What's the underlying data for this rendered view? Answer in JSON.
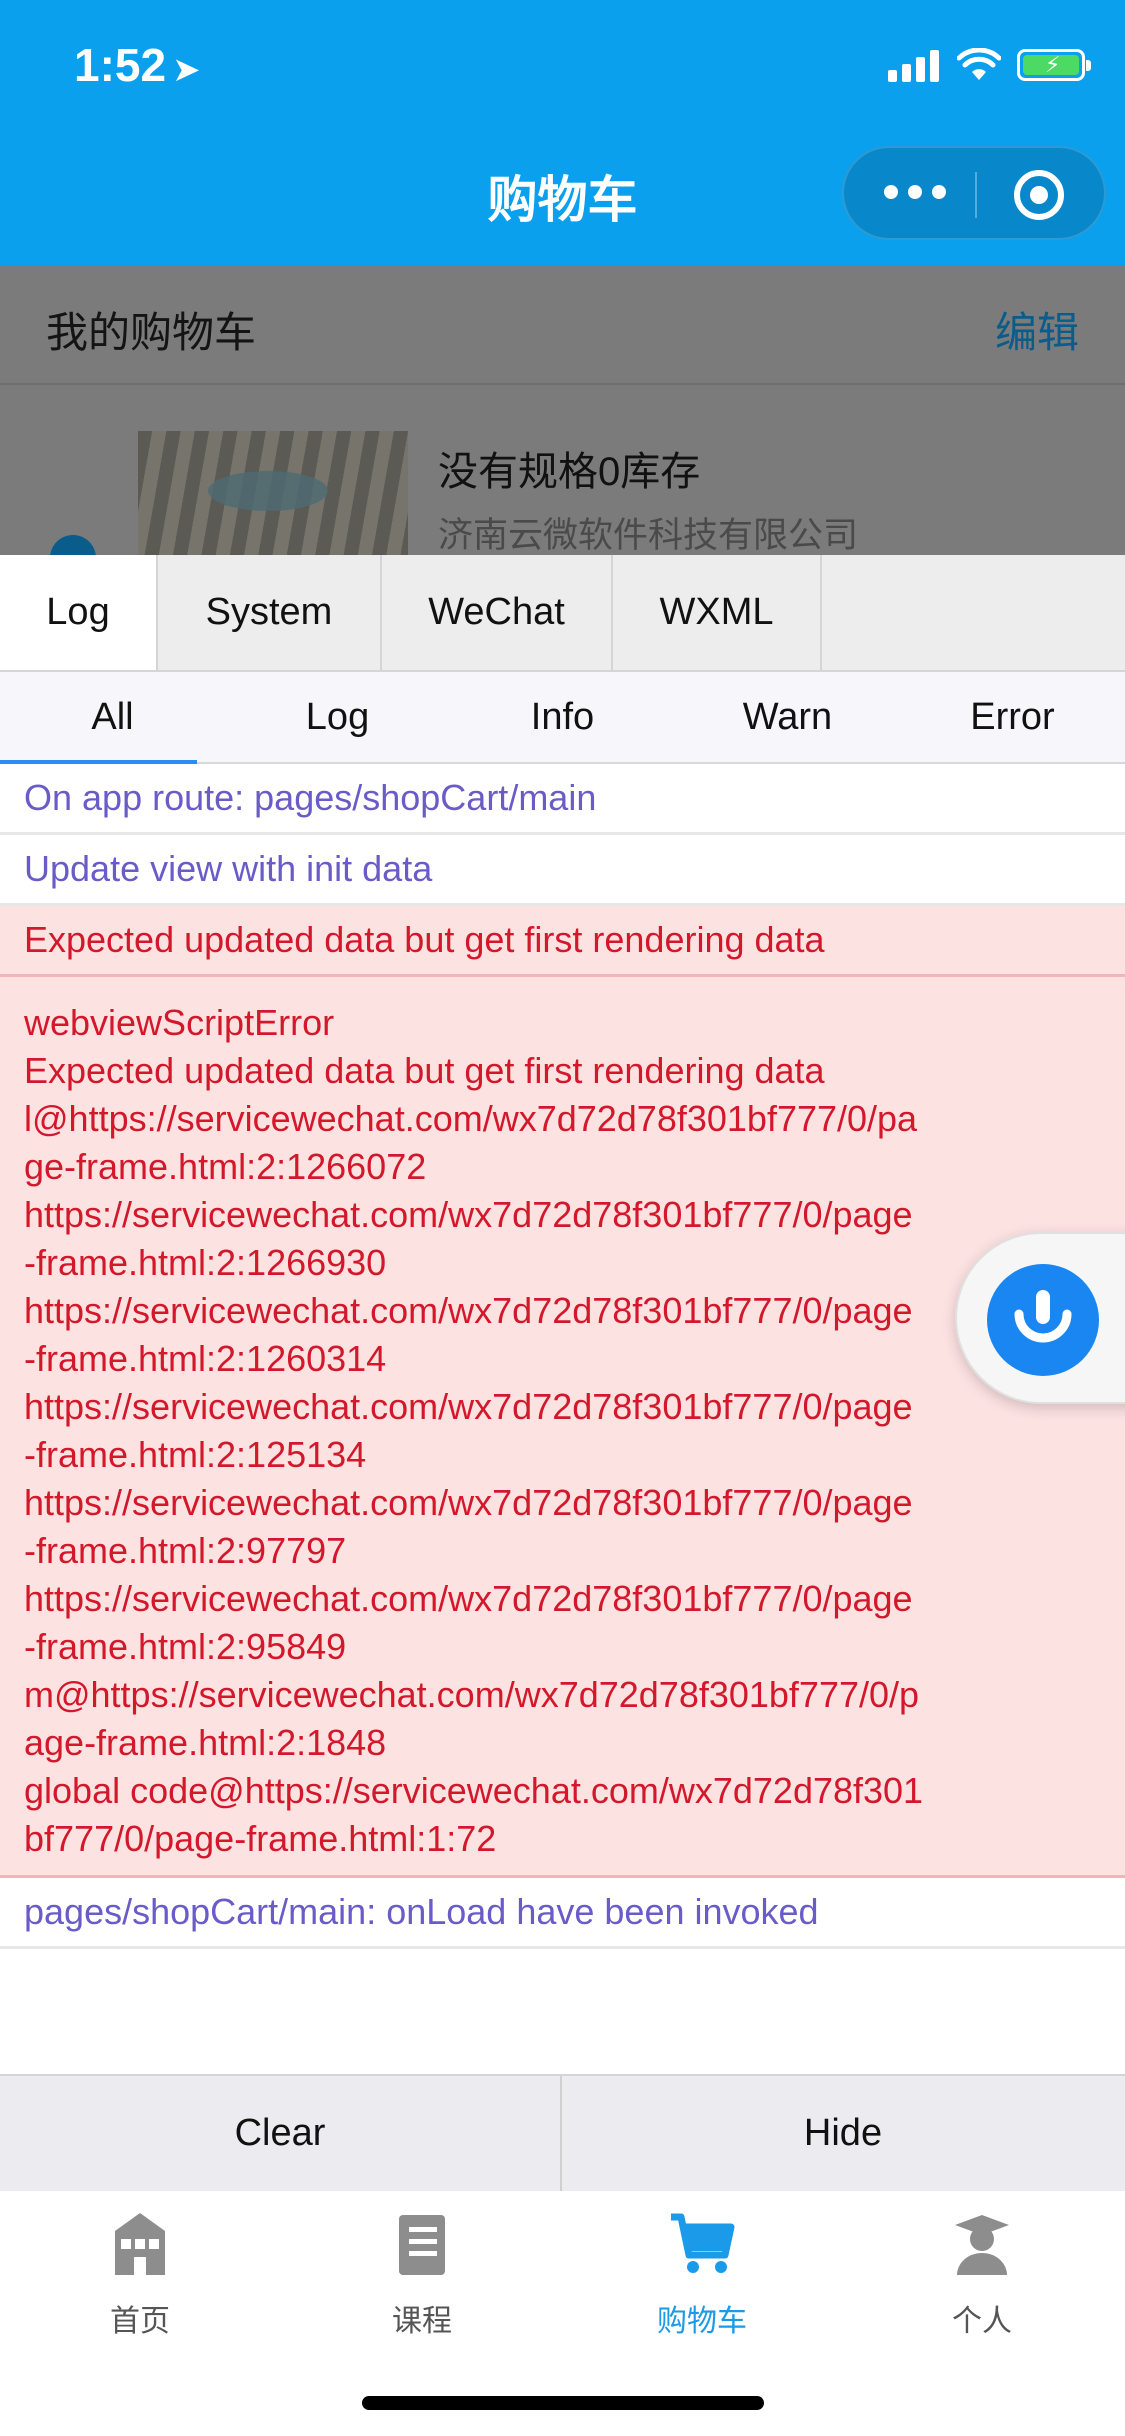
{
  "status_bar": {
    "time": "1:52"
  },
  "nav": {
    "title": "购物车"
  },
  "cart": {
    "header_title": "我的购物车",
    "edit_label": "编辑",
    "item": {
      "name": "没有规格0库存",
      "shop": "济南云微软件科技有限公司"
    }
  },
  "console": {
    "tabs": [
      "Log",
      "System",
      "WeChat",
      "WXML"
    ],
    "subtabs": [
      "All",
      "Log",
      "Info",
      "Warn",
      "Error"
    ],
    "logs": [
      {
        "type": "log",
        "lines": [
          "On app route: pages/shopCart/main"
        ]
      },
      {
        "type": "log",
        "lines": [
          "Update view with init data"
        ]
      },
      {
        "type": "error",
        "lines": [
          "Expected updated data but get first rendering data"
        ]
      },
      {
        "type": "error",
        "lines": [
          "webviewScriptError",
          "Expected updated data but get first rendering data",
          "l@https://servicewechat.com/wx7d72d78f301bf777/0/page-frame.html:2:1266072",
          "https://servicewechat.com/wx7d72d78f301bf777/0/page-frame.html:2:1266930",
          "https://servicewechat.com/wx7d72d78f301bf777/0/page-frame.html:2:1260314",
          "https://servicewechat.com/wx7d72d78f301bf777/0/page-frame.html:2:125134",
          "https://servicewechat.com/wx7d72d78f301bf777/0/page-frame.html:2:97797",
          "https://servicewechat.com/wx7d72d78f301bf777/0/page-frame.html:2:95849",
          "m@https://servicewechat.com/wx7d72d78f301bf777/0/page-frame.html:2:1848",
          "global code@https://servicewechat.com/wx7d72d78f301bf777/0/page-frame.html:1:72"
        ]
      },
      {
        "type": "log",
        "lines": [
          "pages/shopCart/main: onLoad have been invoked"
        ]
      }
    ],
    "clear_label": "Clear",
    "hide_label": "Hide"
  },
  "tabbar": {
    "items": [
      {
        "label": "首页",
        "icon": "home-icon"
      },
      {
        "label": "课程",
        "icon": "book-icon"
      },
      {
        "label": "购物车",
        "icon": "cart-icon"
      },
      {
        "label": "个人",
        "icon": "user-icon"
      }
    ]
  },
  "colors": {
    "nav_bg": "#0aa0ee",
    "log_text": "#6a5cc8",
    "error_text": "#d3182c",
    "error_bg": "#fde2e2",
    "active_tab": "#1a9ae8",
    "subtab_indicator": "#2d8cf0"
  }
}
